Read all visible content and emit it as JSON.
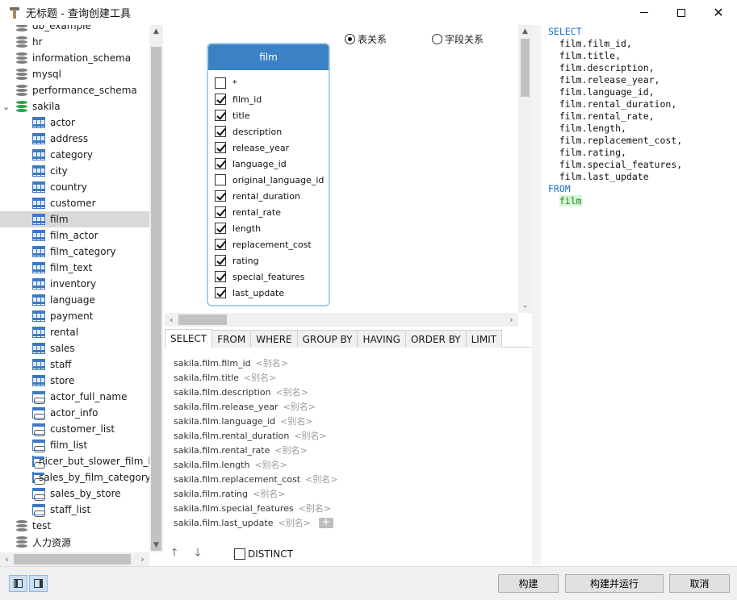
{
  "window": {
    "title": "无标题 - 查询创建工具",
    "controls": {
      "minimize_icon": "minimize-icon",
      "maximize_icon": "maximize-icon",
      "close_label": "✕"
    }
  },
  "tree": {
    "items": [
      {
        "label": "db_example",
        "kind": "database",
        "color": "#7f7f7f"
      },
      {
        "label": "hr",
        "kind": "database",
        "color": "#7f7f7f"
      },
      {
        "label": "information_schema",
        "kind": "database",
        "color": "#7f7f7f"
      },
      {
        "label": "mysql",
        "kind": "database",
        "color": "#7f7f7f"
      },
      {
        "label": "performance_schema",
        "kind": "database",
        "color": "#7f7f7f"
      },
      {
        "label": "sakila",
        "kind": "database-open",
        "color": "#27a844",
        "expander": "⌄"
      },
      {
        "label": "actor",
        "kind": "table"
      },
      {
        "label": "address",
        "kind": "table"
      },
      {
        "label": "category",
        "kind": "table"
      },
      {
        "label": "city",
        "kind": "table"
      },
      {
        "label": "country",
        "kind": "table"
      },
      {
        "label": "customer",
        "kind": "table"
      },
      {
        "label": "film",
        "kind": "table",
        "selected": true
      },
      {
        "label": "film_actor",
        "kind": "table"
      },
      {
        "label": "film_category",
        "kind": "table"
      },
      {
        "label": "film_text",
        "kind": "table"
      },
      {
        "label": "inventory",
        "kind": "table"
      },
      {
        "label": "language",
        "kind": "table"
      },
      {
        "label": "payment",
        "kind": "table"
      },
      {
        "label": "rental",
        "kind": "table"
      },
      {
        "label": "sales",
        "kind": "table"
      },
      {
        "label": "staff",
        "kind": "table"
      },
      {
        "label": "store",
        "kind": "table"
      },
      {
        "label": "actor_full_name",
        "kind": "view"
      },
      {
        "label": "actor_info",
        "kind": "view"
      },
      {
        "label": "customer_list",
        "kind": "view"
      },
      {
        "label": "film_list",
        "kind": "view"
      },
      {
        "label": "nicer_but_slower_film_list",
        "kind": "view"
      },
      {
        "label": "sales_by_film_category",
        "kind": "view"
      },
      {
        "label": "sales_by_store",
        "kind": "view"
      },
      {
        "label": "staff_list",
        "kind": "view"
      },
      {
        "label": "test",
        "kind": "database",
        "color": "#7f7f7f"
      },
      {
        "label": "人力资源",
        "kind": "database",
        "color": "#7f7f7f"
      }
    ],
    "scroll": {
      "up": "▲",
      "down": "▼",
      "left": "‹",
      "right": "›"
    }
  },
  "diagram": {
    "radio_table_relation": {
      "label": "表关系",
      "selected": true
    },
    "radio_field_relation": {
      "label": "字段关系",
      "selected": false
    },
    "table_card": {
      "name": "film",
      "fields": [
        {
          "label": "*",
          "checked": false
        },
        {
          "label": "film_id",
          "checked": true
        },
        {
          "label": "title",
          "checked": true
        },
        {
          "label": "description",
          "checked": true
        },
        {
          "label": "release_year",
          "checked": true
        },
        {
          "label": "language_id",
          "checked": true
        },
        {
          "label": "original_language_id",
          "checked": false
        },
        {
          "label": "rental_duration",
          "checked": true
        },
        {
          "label": "rental_rate",
          "checked": true
        },
        {
          "label": "length",
          "checked": true
        },
        {
          "label": "replacement_cost",
          "checked": true
        },
        {
          "label": "rating",
          "checked": true
        },
        {
          "label": "special_features",
          "checked": true
        },
        {
          "label": "last_update",
          "checked": true
        }
      ]
    },
    "scroll": {
      "up": "▲",
      "down": "⌄",
      "left": "‹",
      "right": "›"
    }
  },
  "clause_tabs": [
    "SELECT",
    "FROM",
    "WHERE",
    "GROUP BY",
    "HAVING",
    "ORDER BY",
    "LIMIT"
  ],
  "active_tab": "SELECT",
  "select_fields": [
    {
      "field": "sakila.film.film_id",
      "alias": "<别名>"
    },
    {
      "field": "sakila.film.title",
      "alias": "<别名>"
    },
    {
      "field": "sakila.film.description",
      "alias": "<别名>"
    },
    {
      "field": "sakila.film.release_year",
      "alias": "<别名>"
    },
    {
      "field": "sakila.film.language_id",
      "alias": "<别名>"
    },
    {
      "field": "sakila.film.rental_duration",
      "alias": "<别名>"
    },
    {
      "field": "sakila.film.rental_rate",
      "alias": "<别名>"
    },
    {
      "field": "sakila.film.length",
      "alias": "<别名>"
    },
    {
      "field": "sakila.film.replacement_cost",
      "alias": "<别名>"
    },
    {
      "field": "sakila.film.rating",
      "alias": "<别名>"
    },
    {
      "field": "sakila.film.special_features",
      "alias": "<别名>"
    },
    {
      "field": "sakila.film.last_update",
      "alias": "<别名>"
    }
  ],
  "add_field_label": "+",
  "bottom_tools": {
    "move_up": "🡑",
    "move_down": "🡓",
    "distinct_label": "DISTINCT",
    "distinct_checked": false
  },
  "sql": {
    "lines": [
      {
        "text": "SELECT",
        "style": "kw"
      },
      {
        "text": "  film.film_id,",
        "style": ""
      },
      {
        "text": "  film.title,",
        "style": ""
      },
      {
        "text": "  film.description,",
        "style": ""
      },
      {
        "text": "  film.release_year,",
        "style": ""
      },
      {
        "text": "  film.language_id,",
        "style": ""
      },
      {
        "text": "  film.rental_duration,",
        "style": ""
      },
      {
        "text": "  film.rental_rate,",
        "style": ""
      },
      {
        "text": "  film.length,",
        "style": ""
      },
      {
        "text": "  film.replacement_cost,",
        "style": ""
      },
      {
        "text": "  film.rating,",
        "style": ""
      },
      {
        "text": "  film.special_features,",
        "style": ""
      },
      {
        "text": "  film.last_update",
        "style": ""
      },
      {
        "text": "FROM",
        "style": "kw"
      },
      {
        "text": "film",
        "style": "hl",
        "indent": "  "
      }
    ]
  },
  "footer": {
    "build_label": "构建",
    "build_run_label": "构建并运行",
    "cancel_label": "取消"
  },
  "colors": {
    "accent": "#3b82c4",
    "keyword": "#1a6fd1",
    "highlight_bg": "#d6f5d6"
  }
}
